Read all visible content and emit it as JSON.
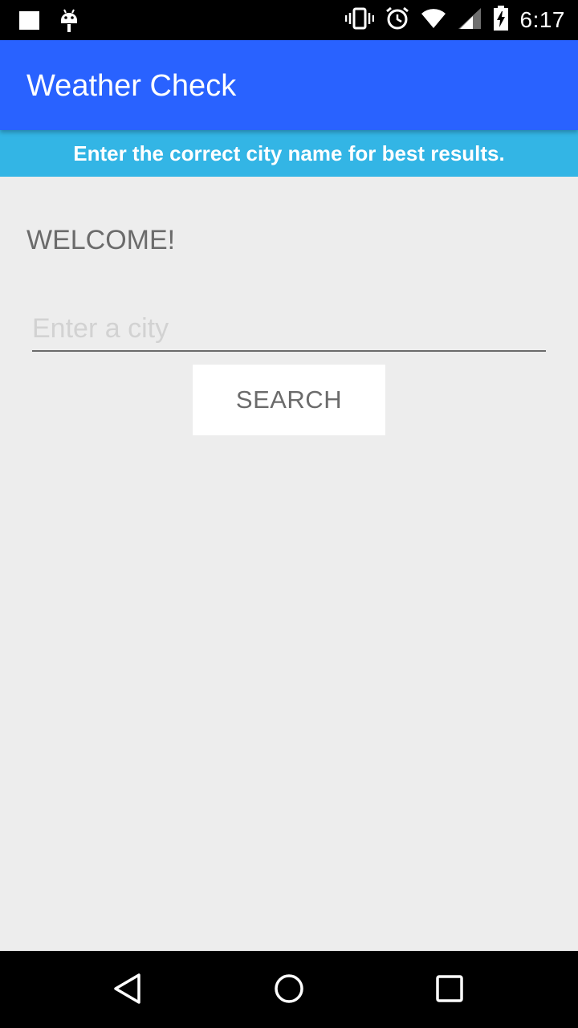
{
  "status_bar": {
    "time": "6:17",
    "icons": [
      "notification-square-icon",
      "android-debug-icon",
      "vibrate-icon",
      "alarm-icon",
      "wifi-icon",
      "cell-signal-icon",
      "battery-charging-icon"
    ]
  },
  "app_bar": {
    "title": "Weather Check",
    "color": "#2962ff"
  },
  "hint_banner": {
    "text": "Enter the correct city name for best results.",
    "color": "#33b5e5"
  },
  "main": {
    "welcome": "WELCOME!",
    "city_input": {
      "placeholder": "Enter a city",
      "value": ""
    },
    "search_button_label": "SEARCH"
  },
  "nav_bar": {
    "icons": [
      "back-icon",
      "home-icon",
      "recents-icon"
    ]
  }
}
